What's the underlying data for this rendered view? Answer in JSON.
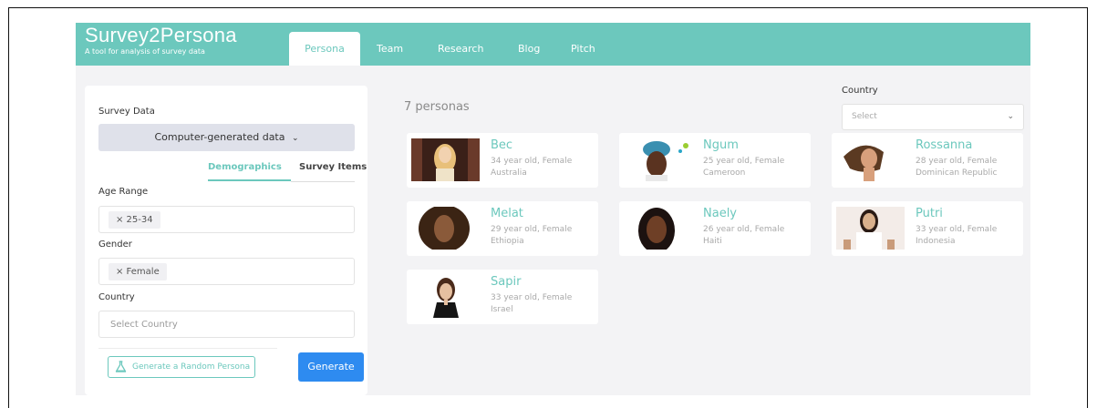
{
  "brand": {
    "title": "Survey2Persona",
    "subtitle": "A tool for analysis of survey data"
  },
  "nav": {
    "tabs": [
      "Persona",
      "Team",
      "Research",
      "Blog",
      "Pitch"
    ],
    "active": "Persona"
  },
  "sidebar": {
    "survey_data_label": "Survey Data",
    "survey_data_value": "Computer-generated data",
    "subtabs": [
      "Demographics",
      "Survey Items"
    ],
    "age_range_label": "Age Range",
    "age_range_chip": "× 25-34",
    "gender_label": "Gender",
    "gender_chip": "× Female",
    "country_label": "Country",
    "country_placeholder": "Select Country",
    "random_button": "Generate a Random Persona",
    "generate_button": "Generate"
  },
  "main": {
    "count_text": "7 personas",
    "country_filter_label": "Country",
    "country_filter_placeholder": "Select",
    "personas": [
      {
        "name": "Bec",
        "desc": "34 year old, Female",
        "country": "Australia"
      },
      {
        "name": "Ngum",
        "desc": "25 year old, Female",
        "country": "Cameroon"
      },
      {
        "name": "Rossanna",
        "desc": "28 year old, Female",
        "country": "Dominican Republic"
      },
      {
        "name": "Melat",
        "desc": "29 year old, Female",
        "country": "Ethiopia"
      },
      {
        "name": "Naely",
        "desc": "26 year old, Female",
        "country": "Haiti"
      },
      {
        "name": "Putri",
        "desc": "33 year old, Female",
        "country": "Indonesia"
      },
      {
        "name": "Sapir",
        "desc": "33 year old, Female",
        "country": "Israel"
      }
    ]
  },
  "colors": {
    "accent": "#6cc8bd",
    "primary_button": "#2e8bf0",
    "background": "#f3f3f5"
  }
}
